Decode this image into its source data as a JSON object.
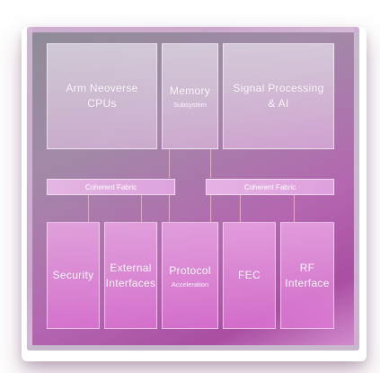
{
  "diagram": {
    "top_blocks": [
      {
        "label": "Arm  Neoverse\nCPUs",
        "sub": ""
      },
      {
        "label": "Memory",
        "sub": "Subsystem"
      },
      {
        "label": "Signal  Processing\n& AI",
        "sub": ""
      }
    ],
    "fabrics": [
      {
        "label": "Coherent Fabric"
      },
      {
        "label": "Coherent Fabric"
      }
    ],
    "bottom_blocks": [
      {
        "label": "Security",
        "sub": ""
      },
      {
        "label": "External\nInterfaces",
        "sub": ""
      },
      {
        "label": "Protocol",
        "sub": "Acceleration"
      },
      {
        "label": "FEC",
        "sub": ""
      },
      {
        "label": "RF\nInterface",
        "sub": ""
      }
    ]
  }
}
